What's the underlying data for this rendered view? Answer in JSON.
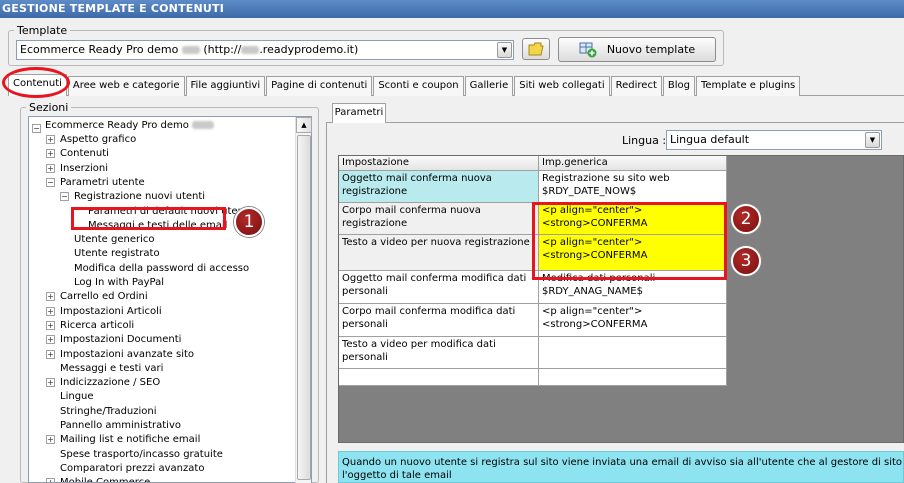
{
  "window": {
    "title": "GESTIONE TEMPLATE E CONTENUTI"
  },
  "template_group": {
    "label": "Template",
    "selected_prefix": "Ecommerce Ready Pro demo",
    "selected_mid": "(http://",
    "selected_suffix": ".readyprodemo.it)",
    "folder_icon": "folder-icon",
    "new_button_label": "Nuovo template",
    "new_button_icon": "add-grid-icon"
  },
  "tabs": [
    {
      "label": "Contenuti",
      "active": true
    },
    {
      "label": "Aree web e categorie"
    },
    {
      "label": "File aggiuntivi"
    },
    {
      "label": "Pagine di contenuti"
    },
    {
      "label": "Sconti e coupon"
    },
    {
      "label": "Gallerie"
    },
    {
      "label": "Siti web collegati"
    },
    {
      "label": "Redirect"
    },
    {
      "label": "Blog"
    },
    {
      "label": "Template e plugins"
    }
  ],
  "sezioni": {
    "label": "Sezioni",
    "root": "Ecommerce Ready Pro demo",
    "items": [
      {
        "label": "Aspetto grafico",
        "exp": "+"
      },
      {
        "label": "Contenuti",
        "exp": "+"
      },
      {
        "label": "Inserzioni",
        "exp": "+"
      },
      {
        "label": "Parametri utente",
        "exp": "-"
      },
      {
        "label": "Registrazione nuovi utenti",
        "exp": "-"
      },
      {
        "label": "Parametri di default nuovi utenti",
        "exp": ""
      },
      {
        "label": "Messaggi e testi delle email",
        "exp": ""
      },
      {
        "label": "Utente generico",
        "exp": ""
      },
      {
        "label": "Utente registrato",
        "exp": ""
      },
      {
        "label": "Modifica della password di accesso",
        "exp": ""
      },
      {
        "label": "Log In with PayPal",
        "exp": ""
      },
      {
        "label": "Carrello ed Ordini",
        "exp": "+"
      },
      {
        "label": "Impostazioni Articoli",
        "exp": "+"
      },
      {
        "label": "Ricerca articoli",
        "exp": "+"
      },
      {
        "label": "Impostazioni Documenti",
        "exp": "+"
      },
      {
        "label": "Impostazioni avanzate sito",
        "exp": "+"
      },
      {
        "label": "Messaggi e testi vari",
        "exp": ""
      },
      {
        "label": "Indicizzazione / SEO",
        "exp": "+"
      },
      {
        "label": "Lingue",
        "exp": ""
      },
      {
        "label": "Stringhe/Traduzioni",
        "exp": ""
      },
      {
        "label": "Pannello amministrativo",
        "exp": ""
      },
      {
        "label": "Mailing list e notifiche email",
        "exp": "+"
      },
      {
        "label": "Spese trasporto/incasso gratuite",
        "exp": ""
      },
      {
        "label": "Comparatori prezzi avanzato",
        "exp": ""
      },
      {
        "label": "Mobile Commerce",
        "exp": "+"
      }
    ]
  },
  "parametri": {
    "tab_label": "Parametri",
    "lingua_label": "Lingua :",
    "lingua_value": "Lingua default",
    "col_impostazione": "Impostazione",
    "col_generica": "Imp.generica",
    "rows": [
      {
        "setting": "Oggetto mail conferma nuova registrazione",
        "value": "Registrazione su sito web $RDY_DATE_NOW$"
      },
      {
        "setting": "Corpo mail conferma nuova registrazione",
        "value": "<p align=\"center\"><strong>CONFERMA"
      },
      {
        "setting": "Testo a video per nuova registrazione",
        "value": "<p align=\"center\"><strong>CONFERMA"
      },
      {
        "setting": "Oggetto mail conferma modifica dati personali",
        "value": "Modifica dati personali $RDY_ANAG_NAME$"
      },
      {
        "setting": "Corpo mail conferma modifica dati personali",
        "value": "<p align=\"center\"><strong>CONFERMA"
      },
      {
        "setting": "Testo a video per modifica dati personali",
        "value": ""
      }
    ],
    "info_line1": "Quando un nuovo utente si registra sul sito viene inviata una email di avviso sia all'utente che al gestore di sito web. Questa im",
    "info_line2": "l'oggetto di tale email"
  },
  "markers": [
    "1",
    "2",
    "3"
  ],
  "colors": {
    "highlight_red": "#e8141e",
    "marker": "#8b1a1a",
    "yellow": "#ffff00",
    "selected_row": "#b8eaee",
    "info_bg": "#8ee3f0"
  }
}
